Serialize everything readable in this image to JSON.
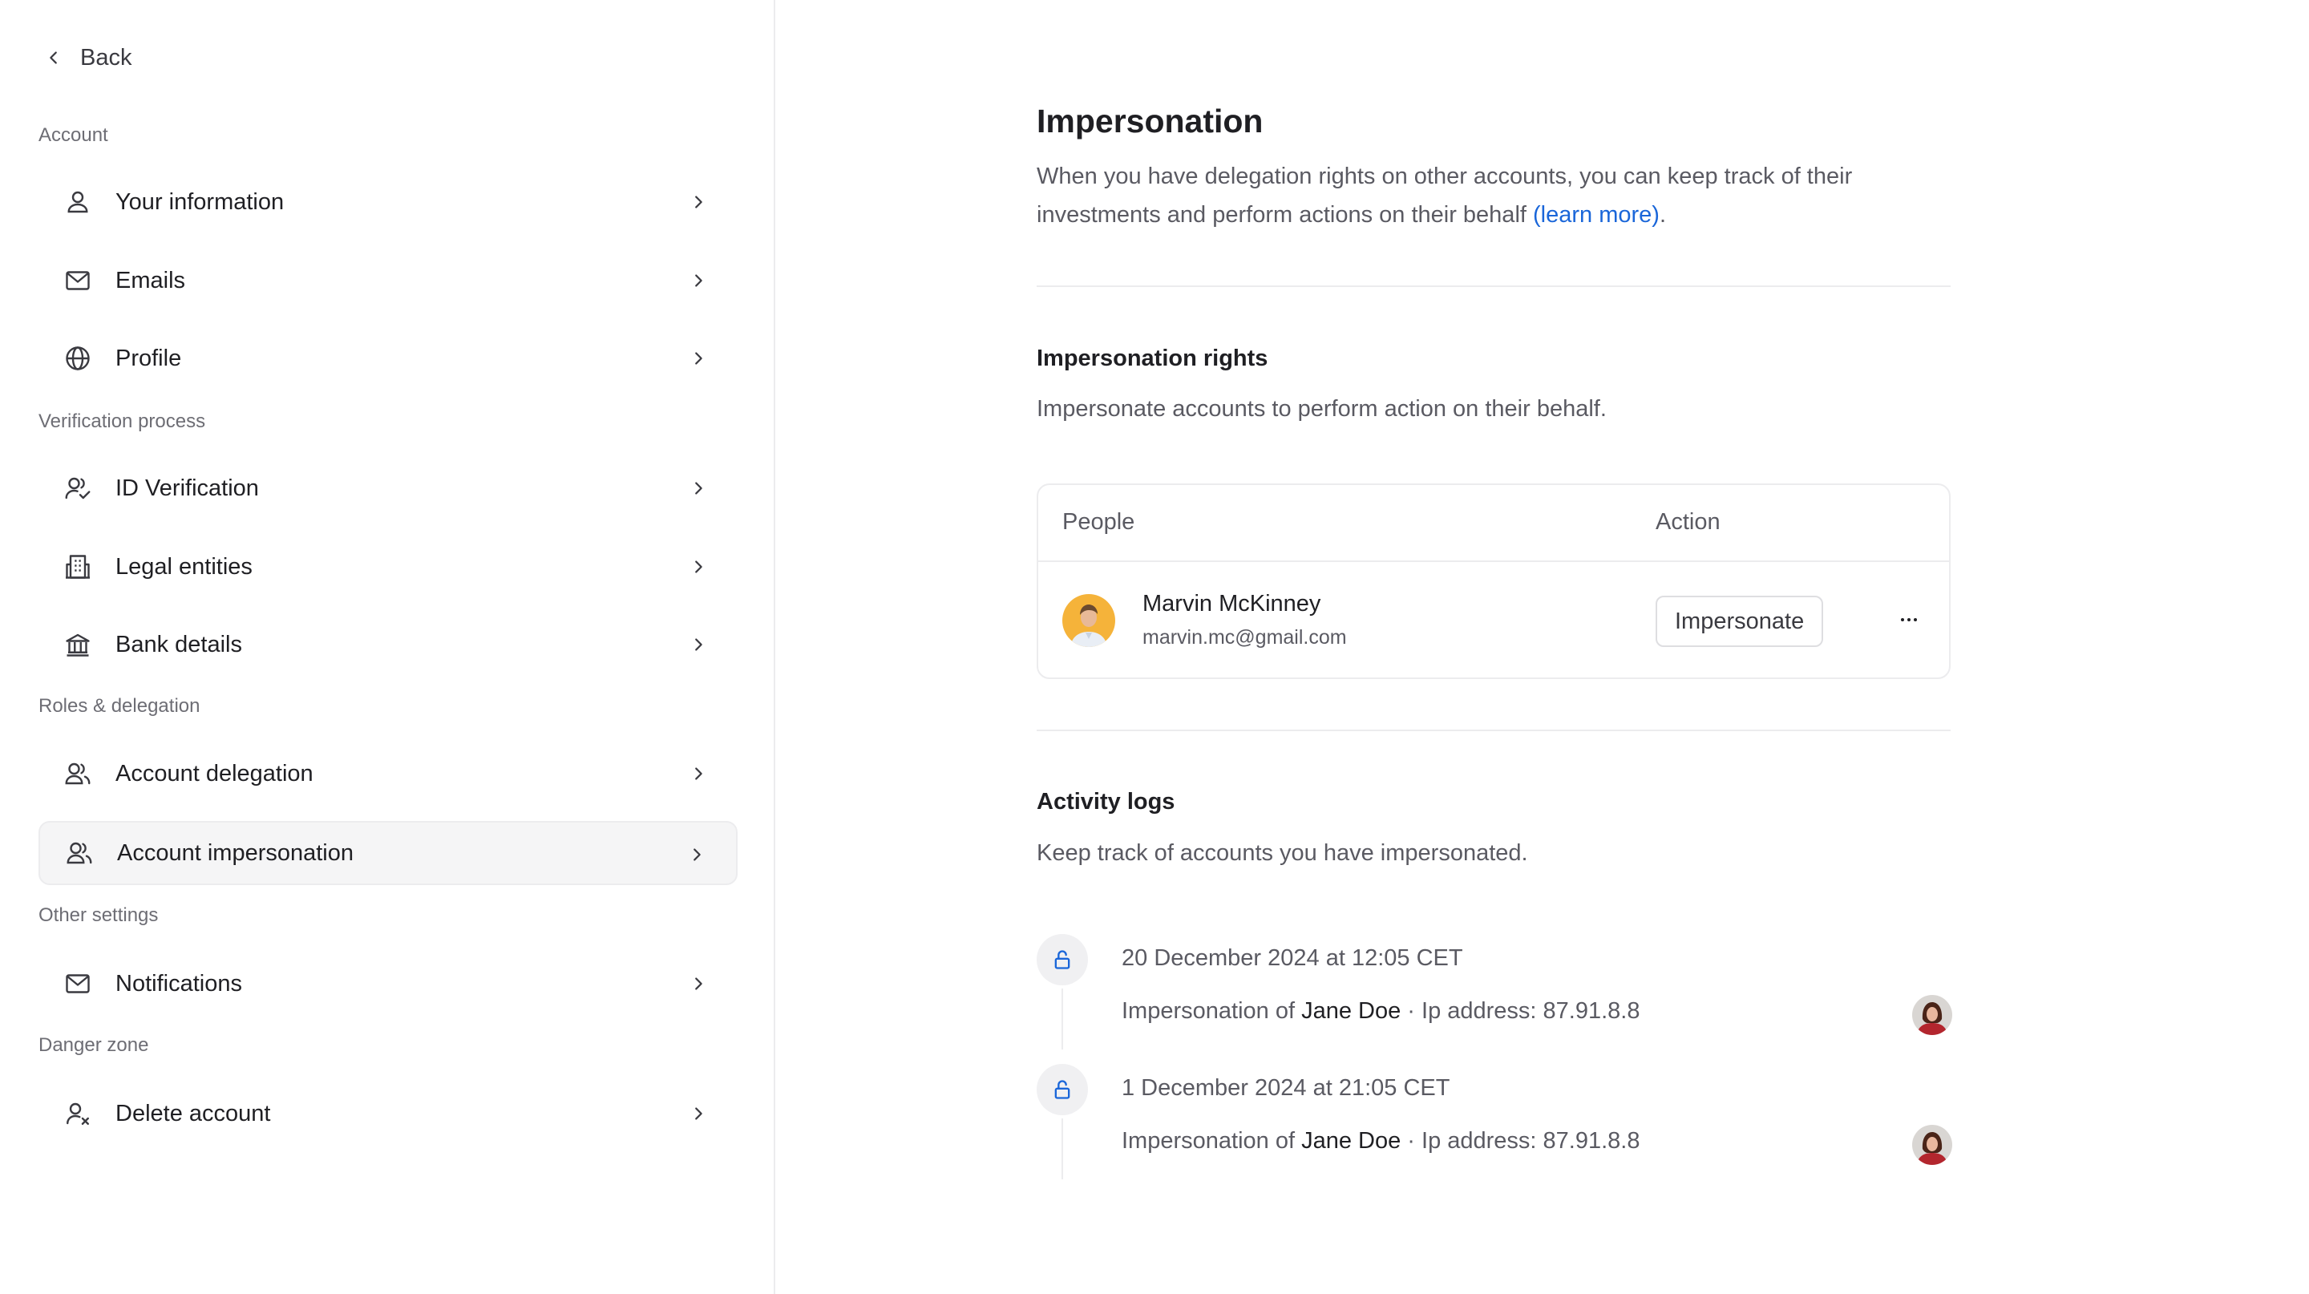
{
  "sidebar": {
    "back_label": "Back",
    "sections": {
      "account": "Account",
      "verification": "Verification process",
      "roles": "Roles & delegation",
      "other": "Other settings",
      "danger": "Danger zone"
    },
    "items": [
      {
        "label": "Your information",
        "icon": "user-icon"
      },
      {
        "label": "Emails",
        "icon": "mail-icon"
      },
      {
        "label": "Profile",
        "icon": "globe-icon"
      },
      {
        "label": "ID Verification",
        "icon": "user-check-icon"
      },
      {
        "label": "Legal entities",
        "icon": "building-icon"
      },
      {
        "label": "Bank details",
        "icon": "bank-icon"
      },
      {
        "label": "Account delegation",
        "icon": "users-icon"
      },
      {
        "label": "Account impersonation",
        "icon": "users-icon",
        "active": true
      },
      {
        "label": "Notifications",
        "icon": "mail-icon"
      },
      {
        "label": "Delete account",
        "icon": "user-x-icon"
      }
    ]
  },
  "main": {
    "title": "Impersonation",
    "description": "When you have delegation rights on other accounts, you can keep track of their investments and perform actions on their behalf ",
    "learn_more": "(learn more)",
    "description_end": ".",
    "rights": {
      "title": "Impersonation rights",
      "subtitle": "Impersonate accounts to perform action on their behalf.",
      "columns": [
        "People",
        "Action"
      ],
      "people": [
        {
          "name": "Marvin McKinney",
          "email": "marvin.mc@gmail.com",
          "action": "Impersonate"
        }
      ]
    },
    "logs": {
      "title": "Activity logs",
      "subtitle": "Keep track of accounts you have impersonated.",
      "entries": [
        {
          "date": "20 December 2024 at 12:05 CET",
          "prefix": "Impersonation of ",
          "who": "Jane Doe",
          "suffix": " · Ip address: 87.91.8.8"
        },
        {
          "date": "1 December 2024 at 21:05 CET",
          "prefix": "Impersonation of ",
          "who": "Jane Doe",
          "suffix": " · Ip address: 87.91.8.8"
        }
      ]
    }
  },
  "colors": {
    "accent": "#1a66d9",
    "border": "#ececee",
    "active_bg": "#f5f5f6"
  }
}
